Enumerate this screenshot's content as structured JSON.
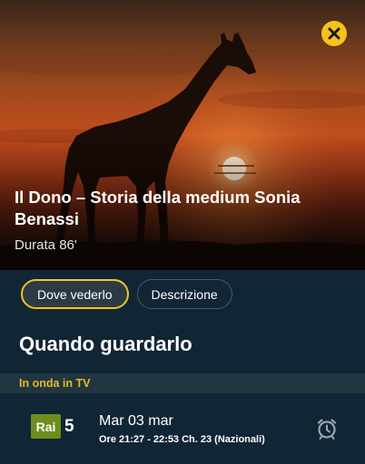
{
  "hero": {
    "title": "Il Dono – Storia della medium Sonia Benassi",
    "duration": "Durata 86'"
  },
  "close": {
    "icon": "close-icon",
    "color": "#f5c31c"
  },
  "tabs": [
    {
      "label": "Dove vederlo",
      "active": true
    },
    {
      "label": "Descrizione",
      "active": false
    }
  ],
  "section": {
    "title": "Quando guardarlo"
  },
  "band": {
    "label": "In onda in TV"
  },
  "schedule": {
    "channel": {
      "logo_text": "Rai",
      "logo_number": "5",
      "logo_color": "#6d8d1c"
    },
    "day": "Mar 03 mar",
    "time": "Ore 21:27 - 22:53 Ch. 23 (Nazionali)",
    "reminder_icon": "alarm-clock-icon"
  },
  "colors": {
    "accent": "#f5c31c",
    "background": "#112634",
    "band": "#20373f",
    "band_text": "#e8b824"
  }
}
